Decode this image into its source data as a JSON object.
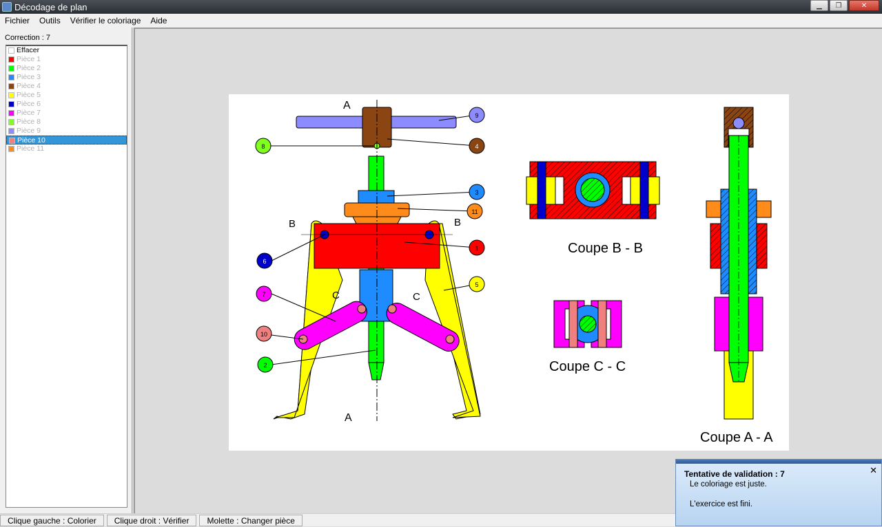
{
  "window": {
    "title": "Décodage de plan"
  },
  "menu": {
    "items": [
      "Fichier",
      "Outils",
      "Vérifier le coloriage",
      "Aide"
    ]
  },
  "sidebar": {
    "correction": "Correction : 7",
    "items": [
      {
        "label": "Effacer",
        "color": "#ffffff"
      },
      {
        "label": "Pièce 1",
        "color": "#ff0000"
      },
      {
        "label": "Pièce 2",
        "color": "#00ff00"
      },
      {
        "label": "Pièce 3",
        "color": "#1e8cff"
      },
      {
        "label": "Pièce 4",
        "color": "#8b4513"
      },
      {
        "label": "Pièce 5",
        "color": "#ffff00"
      },
      {
        "label": "Pièce 6",
        "color": "#0000cc"
      },
      {
        "label": "Pièce 7",
        "color": "#ff00ff"
      },
      {
        "label": "Pièce 8",
        "color": "#80ff20"
      },
      {
        "label": "Pièce 9",
        "color": "#8c8cff"
      },
      {
        "label": "Pièce 10",
        "color": "#f08080"
      },
      {
        "label": "Pièce 11",
        "color": "#ff8c1a"
      }
    ],
    "selected_index": 10
  },
  "drawing": {
    "section_bb": "Coupe B - B",
    "section_cc": "Coupe C - C",
    "section_aa": "Coupe A - A",
    "marks": {
      "a": "A",
      "b": "B",
      "c": "C"
    },
    "callouts": [
      "9",
      "8",
      "4",
      "3",
      "11",
      "6",
      "1",
      "5",
      "7",
      "10",
      "2"
    ]
  },
  "status": {
    "left": "Clique gauche : Colorier",
    "right": "Clique droit : Vérifier",
    "wheel": "Molette : Changer pièce"
  },
  "popup": {
    "title": "Tentative de validation : 7",
    "line1": "Le coloriage est juste.",
    "line2": "L'exercice est fini."
  }
}
